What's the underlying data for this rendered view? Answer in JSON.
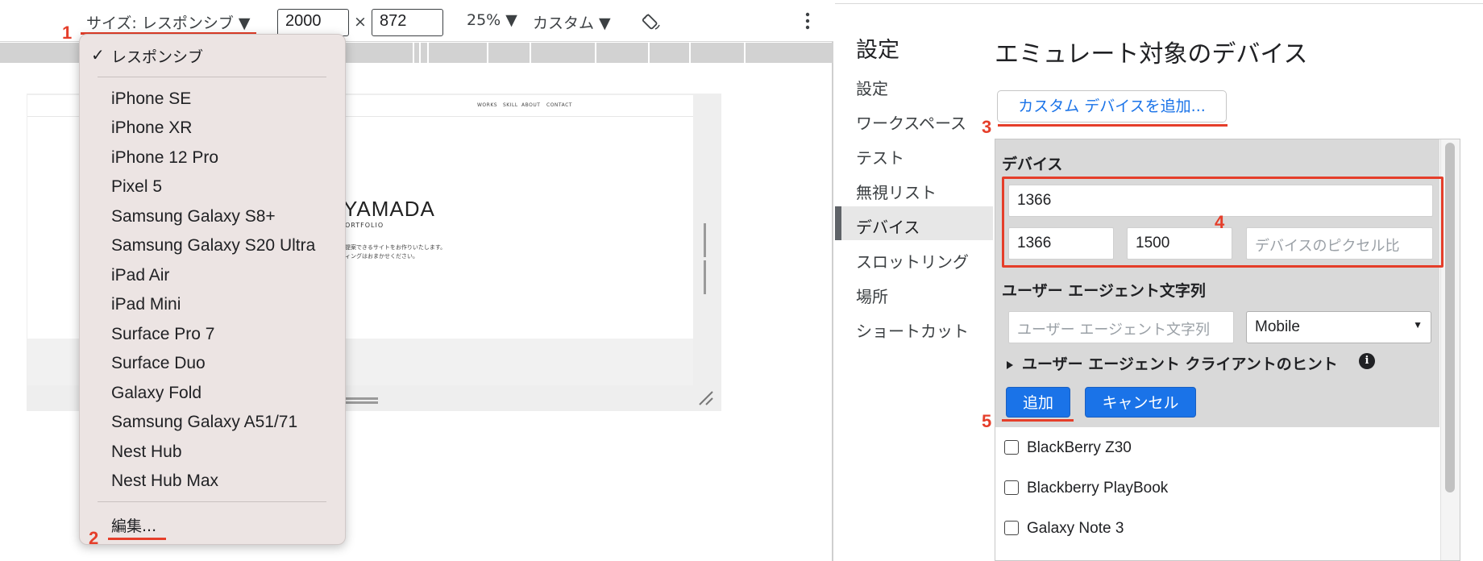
{
  "toolbar": {
    "size_label": "サイズ: レスポンシブ ▼",
    "width": "2000",
    "times": "×",
    "height": "872",
    "zoom": "25% ▼",
    "throttle": "カスタム ▼",
    "rotate_icon": "rotate-icon",
    "more_icon": "more-vertical-icon"
  },
  "preview": {
    "nav": [
      "WORKS",
      "SKILL",
      "ABOUT",
      "CONTACT"
    ],
    "name_fragment": "YAMADA",
    "sub_fragment": "ORTFOLIO",
    "line1": "提案できるサイトをお作りいたします。",
    "line2": "ィングはおまかせください。"
  },
  "menu": {
    "checked": "✓",
    "responsive": "レスポンシブ",
    "items": [
      "iPhone SE",
      "iPhone XR",
      "iPhone 12 Pro",
      "Pixel 5",
      "Samsung Galaxy S8+",
      "Samsung Galaxy S20 Ultra",
      "iPad Air",
      "iPad Mini",
      "Surface Pro 7",
      "Surface Duo",
      "Galaxy Fold",
      "Samsung Galaxy A51/71",
      "Nest Hub",
      "Nest Hub Max"
    ],
    "edit": "編集..."
  },
  "markers": [
    "1",
    "2",
    "3",
    "4",
    "5"
  ],
  "settings": {
    "title": "設定",
    "nav": [
      "設定",
      "ワークスペース",
      "テスト",
      "無視リスト",
      "デバイス",
      "スロットリング",
      "場所",
      "ショートカット"
    ],
    "active": "デバイス"
  },
  "devices": {
    "title": "エミュレート対象のデバイス",
    "add_custom": "カスタム デバイスを追加...",
    "form_label": "デバイス",
    "name_value": "1366",
    "width_value": "1366",
    "height_value": "1500",
    "dpr_placeholder": "デバイスのピクセル比",
    "ua_label": "ユーザー エージェント文字列",
    "ua_placeholder": "ユーザー エージェント文字列",
    "ua_type": "Mobile",
    "hints": "ユーザー エージェント クライアントのヒント",
    "add_button": "追加",
    "cancel_button": "キャンセル",
    "list": [
      "BlackBerry Z30",
      "Blackberry PlayBook",
      "Galaxy Note 3"
    ]
  },
  "colors": {
    "accent": "#1a73e8",
    "annotation": "#e53e2a",
    "menu_bg": "#ece4e3"
  }
}
